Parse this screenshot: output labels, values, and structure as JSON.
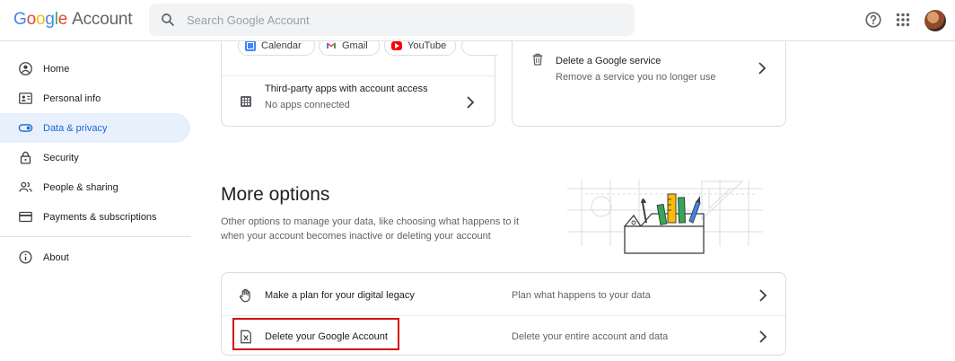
{
  "header": {
    "logo_letters": [
      "G",
      "o",
      "o",
      "g",
      "l",
      "e"
    ],
    "logo_product": "Account",
    "search_placeholder": "Search Google Account",
    "icons": [
      "search-icon",
      "help-icon",
      "apps-grid-icon",
      "avatar"
    ]
  },
  "sidebar": {
    "items": [
      {
        "label": "Home",
        "icon": "home-icon",
        "active": false
      },
      {
        "label": "Personal info",
        "icon": "id-card-icon",
        "active": false
      },
      {
        "label": "Data & privacy",
        "icon": "toggle-icon",
        "active": true
      },
      {
        "label": "Security",
        "icon": "lock-icon",
        "active": false
      },
      {
        "label": "People & sharing",
        "icon": "people-icon",
        "active": false
      },
      {
        "label": "Payments & subscriptions",
        "icon": "card-icon",
        "active": false
      },
      {
        "label": "About",
        "icon": "info-icon",
        "active": false
      }
    ]
  },
  "services_card": {
    "chips": [
      {
        "label": "Calendar",
        "icon": "calendar-icon"
      },
      {
        "label": "Gmail",
        "icon": "gmail-icon"
      },
      {
        "label": "YouTube",
        "icon": "youtube-icon"
      }
    ],
    "third_party": {
      "title": "Third-party apps with account access",
      "subtitle": "No apps connected"
    }
  },
  "delete_service_card": {
    "title": "Delete a Google service",
    "subtitle": "Remove a service you no longer use"
  },
  "more_options": {
    "title": "More options",
    "description": "Other options to manage your data, like choosing what happens to it when your account becomes inactive or deleting your account",
    "rows": [
      {
        "title": "Make a plan for your digital legacy",
        "description": "Plan what happens to your data",
        "icon": "hand-icon"
      },
      {
        "title": "Delete your Google Account",
        "description": "Delete your entire account and data",
        "icon": "delete-account-icon"
      }
    ]
  },
  "colors": {
    "accent": "#1967d2",
    "active_bg": "#e8f0fe",
    "highlight_border": "#d10b0b"
  }
}
